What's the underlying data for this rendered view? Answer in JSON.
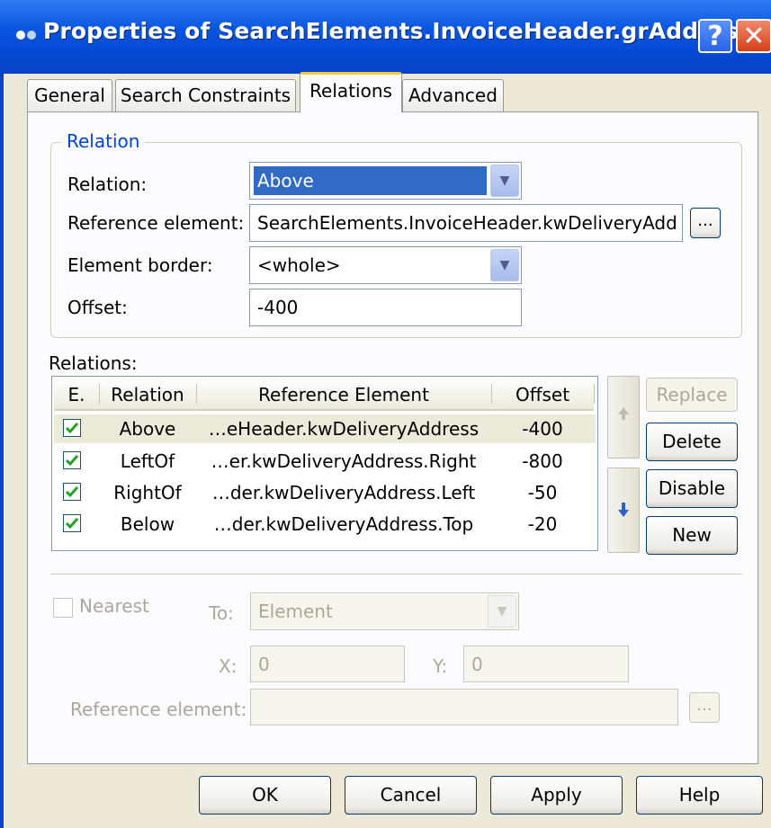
{
  "window": {
    "title": "Properties of SearchElements.InvoiceHeader.grAddress",
    "help_glyph": "?",
    "close_glyph": "✕"
  },
  "tabs": [
    {
      "label": "General"
    },
    {
      "label": "Search Constraints"
    },
    {
      "label": "Relations",
      "active": true
    },
    {
      "label": "Advanced"
    }
  ],
  "relation_group": {
    "legend": "Relation",
    "relation_label": "Relation:",
    "relation_value": "Above",
    "reference_label": "Reference element:",
    "reference_value": "SearchElements.InvoiceHeader.kwDeliveryAdd",
    "browse_label": "...",
    "border_label": "Element border:",
    "border_value": "<whole>",
    "offset_label": "Offset:",
    "offset_value": "-400"
  },
  "relations_list": {
    "label": "Relations:",
    "columns": [
      "E.",
      "Relation",
      "Reference Element",
      "Offset"
    ],
    "rows": [
      {
        "enabled": true,
        "relation": "Above",
        "reference": "…eHeader.kwDeliveryAddress",
        "offset": "-400"
      },
      {
        "enabled": true,
        "relation": "LeftOf",
        "reference": "…er.kwDeliveryAddress.Right",
        "offset": "-800"
      },
      {
        "enabled": true,
        "relation": "RightOf",
        "reference": "…der.kwDeliveryAddress.Left",
        "offset": "-50"
      },
      {
        "enabled": true,
        "relation": "Below",
        "reference": "…der.kwDeliveryAddress.Top",
        "offset": "-20"
      }
    ]
  },
  "side_buttons": {
    "replace": "Replace",
    "delete": "Delete",
    "disable": "Disable",
    "new": "New"
  },
  "nearest": {
    "checkbox_label": "Nearest",
    "to_label": "To:",
    "to_value": "Element",
    "x_label": "X:",
    "x_value": "0",
    "y_label": "Y:",
    "y_value": "0",
    "ref_label": "Reference element:",
    "ref_value": "",
    "browse_label": "..."
  },
  "footer": {
    "ok": "OK",
    "cancel": "Cancel",
    "apply": "Apply",
    "help": "Help"
  },
  "colors": {
    "titlebar": "#0a55e0",
    "selection": "#316ac5",
    "group_legend": "#0046d5",
    "dialog_face": "#ece9d8"
  }
}
